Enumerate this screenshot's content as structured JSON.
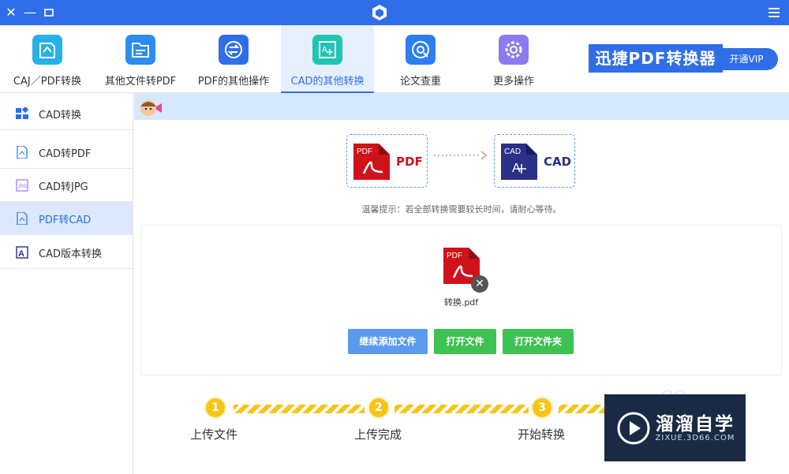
{
  "titlebar": {
    "close_glyph": "✕",
    "min_glyph": "—",
    "max_glyph": "▭",
    "logo_icon": "app-cube-icon",
    "menu_icon": "hamburger-menu-icon"
  },
  "toolbar": {
    "tools": [
      {
        "label": "CAJ／PDF转换",
        "icon": "caj-pdf-convert-icon",
        "color": "#26b1e8"
      },
      {
        "label": "其他文件转PDF",
        "icon": "file-to-pdf-icon",
        "color": "#2d8cf0"
      },
      {
        "label": "PDF的其他操作",
        "icon": "pdf-operations-icon",
        "color": "#2f6ee8"
      },
      {
        "label": "CAD的其他转换",
        "icon": "cad-convert-icon",
        "color": "#22c4b6"
      },
      {
        "label": "论文查重",
        "icon": "paper-check-icon",
        "color": "#2f7ef0"
      },
      {
        "label": "更多操作",
        "icon": "more-gear-icon",
        "color": "#8a7cf0"
      }
    ],
    "active_index": 3,
    "brand": "迅捷PDF转换器",
    "vip_label": "开通VIP"
  },
  "sidebar": {
    "items": [
      {
        "label": "CAD转换",
        "icon": "grid-icon"
      },
      {
        "label": "CAD转PDF",
        "icon": "pdf-file-icon"
      },
      {
        "label": "CAD转JPG",
        "icon": "jpg-file-icon"
      },
      {
        "label": "PDF转CAD",
        "icon": "pdf-file-icon"
      },
      {
        "label": "CAD版本转换",
        "icon": "cad-file-icon"
      }
    ],
    "active_index": 3
  },
  "conversion": {
    "from_label": "PDF",
    "from_icon_text": "PDF",
    "to_label": "CAD",
    "to_icon_text": "CAD",
    "tip": "温馨提示：若全部转换需要较长时间，请耐心等待。"
  },
  "file": {
    "name": "转换.pdf",
    "icon_text": "PDF",
    "remove_glyph": "✕"
  },
  "actions": {
    "add_label": "继续添加文件",
    "open_file_label": "打开文件",
    "open_folder_label": "打开文件夹"
  },
  "steps": [
    {
      "num": "1",
      "label": "上传文件"
    },
    {
      "num": "2",
      "label": "上传完成"
    },
    {
      "num": "3",
      "label": "开始转换"
    }
  ],
  "watermark": {
    "title": "溜溜自学",
    "subtitle": "ZIXUE.3D66.COM"
  },
  "colors": {
    "primary": "#2f6ee8",
    "green": "#3ec252",
    "accent_blue": "#5a9bef",
    "step_yellow": "#f5c518",
    "pdf_red": "#d0121b",
    "cad_navy": "#2b2f86"
  }
}
